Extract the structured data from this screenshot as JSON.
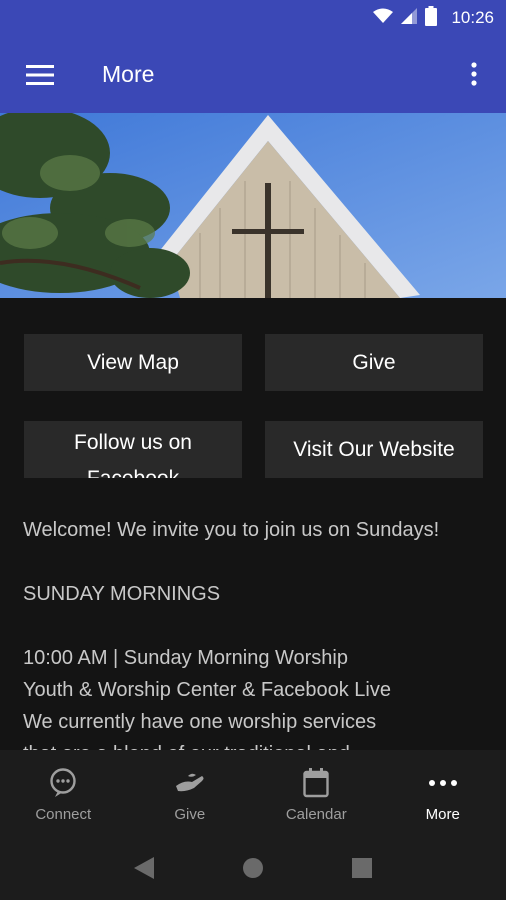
{
  "status_bar": {
    "time": "10:26",
    "icons": [
      "wifi-icon",
      "signal-icon",
      "battery-icon"
    ]
  },
  "app_bar": {
    "title": "More",
    "menu_icon": "hamburger-menu-icon",
    "overflow_icon": "more-vert-icon"
  },
  "hero": {
    "image": "church-steeple-photo"
  },
  "buttons": {
    "view_map": "View Map",
    "give": "Give",
    "facebook_line1": "Follow us on",
    "facebook_line2": "Facebook",
    "website": "Visit Our Website"
  },
  "body": {
    "welcome": "Welcome! We invite you to join us on Sundays!",
    "heading": "SUNDAY MORNINGS",
    "line1": "10:00 AM  | Sunday Morning Worship",
    "line2": "Youth & Worship Center & Facebook Live",
    "line3": "We currently have one worship services",
    "line4": "that are a blend of our traditional and"
  },
  "bottom_nav": {
    "items": [
      {
        "label": "Connect",
        "icon": "chat-bubble-icon",
        "active": false
      },
      {
        "label": "Give",
        "icon": "giving-hand-icon",
        "active": false
      },
      {
        "label": "Calendar",
        "icon": "calendar-icon",
        "active": false
      },
      {
        "label": "More",
        "icon": "more-horiz-icon",
        "active": true
      }
    ]
  },
  "colors": {
    "app_bar": "#3b48b6",
    "background": "#141414",
    "tile": "#292929",
    "nav": "#1c1c1c"
  }
}
